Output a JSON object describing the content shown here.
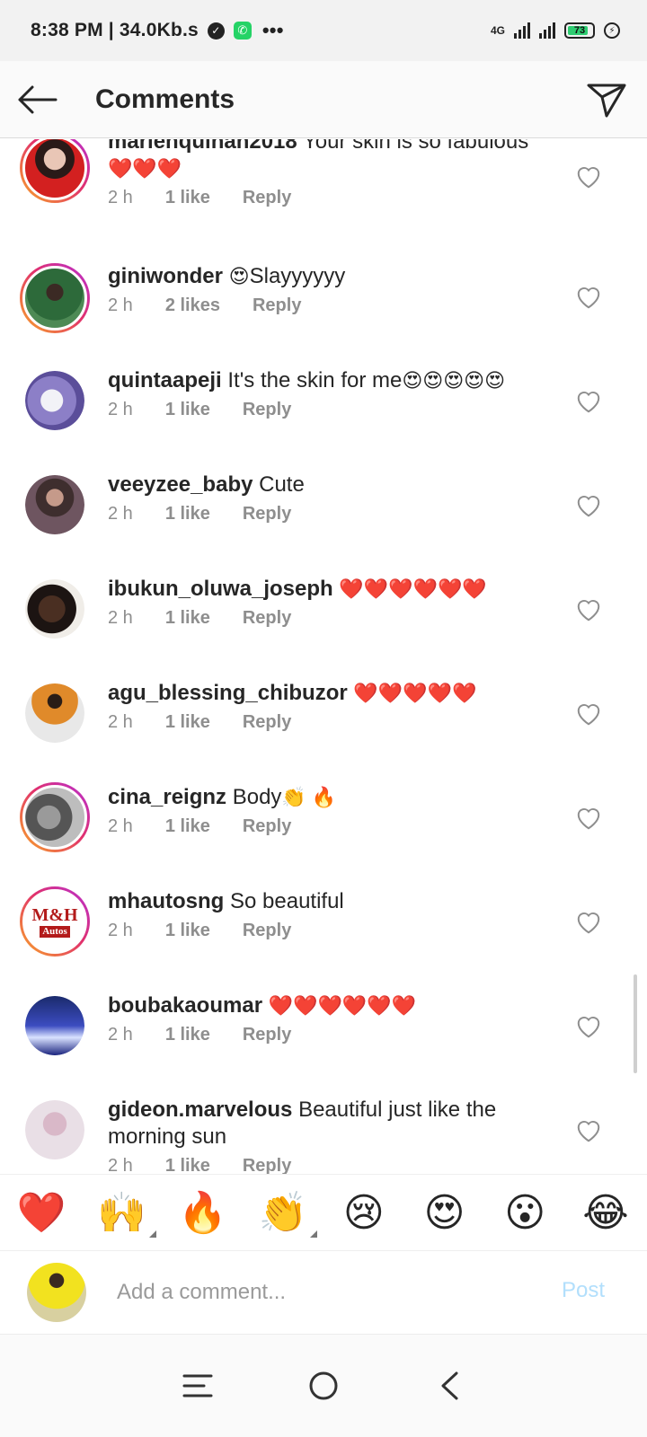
{
  "status_bar": {
    "time_speed": "8:38 PM | 34.0Kb.s",
    "network": "4G",
    "battery": "73"
  },
  "header": {
    "title": "Comments"
  },
  "comments": [
    {
      "username": "marienquinah2018",
      "text": "Your skin is so fabulous",
      "emoji": "❤️❤️❤️",
      "time": "2 h",
      "likes": "1 like",
      "reply": "Reply",
      "ring": true
    },
    {
      "username": "giniwonder",
      "text": "Slayyyyyy",
      "emoji_before": "😍",
      "time": "2 h",
      "likes": "2 likes",
      "reply": "Reply",
      "ring": true
    },
    {
      "username": "quintaapeji",
      "text": "It's the skin for me",
      "emoji": "😍😍😍😍😍",
      "time": "2 h",
      "likes": "1 like",
      "reply": "Reply",
      "ring": false
    },
    {
      "username": "veeyzee_baby",
      "text": "Cute",
      "time": "2 h",
      "likes": "1 like",
      "reply": "Reply",
      "ring": false
    },
    {
      "username": "ibukun_oluwa_joseph",
      "text": "",
      "emoji": "❤️❤️❤️❤️❤️❤️",
      "time": "2 h",
      "likes": "1 like",
      "reply": "Reply",
      "ring": false
    },
    {
      "username": "agu_blessing_chibuzor",
      "text": "",
      "emoji": "❤️❤️❤️❤️❤️",
      "time": "2 h",
      "likes": "1 like",
      "reply": "Reply",
      "ring": false
    },
    {
      "username": "cina_reignz",
      "text": "Body",
      "emoji": "👏 🔥",
      "time": "2 h",
      "likes": "1 like",
      "reply": "Reply",
      "ring": true
    },
    {
      "username": "mhautosng",
      "text": "So beautiful",
      "time": "2 h",
      "likes": "1 like",
      "reply": "Reply",
      "ring": true,
      "avatar_text": "M&H",
      "avatar_sub": "Autos"
    },
    {
      "username": "boubakaoumar",
      "text": "",
      "emoji": "❤️❤️❤️❤️❤️❤️",
      "time": "2 h",
      "likes": "1 like",
      "reply": "Reply",
      "ring": false
    },
    {
      "username": "gideon.marvelous",
      "text": "Beautiful just like the morning sun",
      "time": "2 h",
      "likes": "1 like",
      "reply": "Reply",
      "ring": false
    }
  ],
  "emoji_bar": [
    "❤️",
    "🙌",
    "🔥",
    "👏",
    "😢",
    "😍",
    "😮",
    "😂"
  ],
  "compose": {
    "placeholder": "Add a comment...",
    "post_label": "Post"
  },
  "colors": {
    "accent_disabled": "#b2dffc",
    "text": "#262626",
    "meta": "#8e8e8e"
  }
}
